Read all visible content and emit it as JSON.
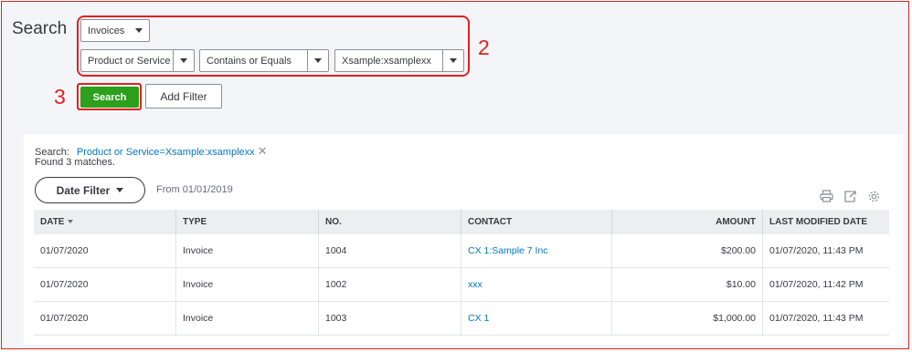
{
  "page": {
    "title": "Search"
  },
  "filters": {
    "type_select": "Invoices",
    "field_select": "Product or Service",
    "operator_select": "Contains or Equals",
    "value_select": "Xsample:xsamplexx"
  },
  "annotations": {
    "filters_marker": "2",
    "search_marker": "3",
    "color": "#e02020"
  },
  "buttons": {
    "search_label": "Search",
    "add_filter_label": "Add Filter"
  },
  "results": {
    "search_prefix": "Search:",
    "criteria": "Product or Service=Xsample:xsamplexx",
    "found": "Found 3 matches.",
    "date_filter_label": "Date Filter",
    "from_label": "From 01/01/2019",
    "columns": [
      "DATE",
      "TYPE",
      "NO.",
      "CONTACT",
      "AMOUNT",
      "LAST MODIFIED DATE"
    ],
    "rows": [
      [
        "01/07/2020",
        "Invoice",
        "1004",
        "CX 1:Sample 7 Inc",
        "$200.00",
        "01/07/2020, 11:43 PM"
      ],
      [
        "01/07/2020",
        "Invoice",
        "1002",
        "xxx",
        "$10.00",
        "01/07/2020, 11:42 PM"
      ],
      [
        "01/07/2020",
        "Invoice",
        "1003",
        "CX 1",
        "$1,000.00",
        "01/07/2020, 11:43 PM"
      ]
    ]
  },
  "toolbar_icons": [
    "print-icon",
    "export-icon",
    "gear-icon"
  ],
  "colors": {
    "accent_green": "#2ca01c",
    "link_blue": "#0077c5",
    "annotation_red": "#e02020"
  }
}
